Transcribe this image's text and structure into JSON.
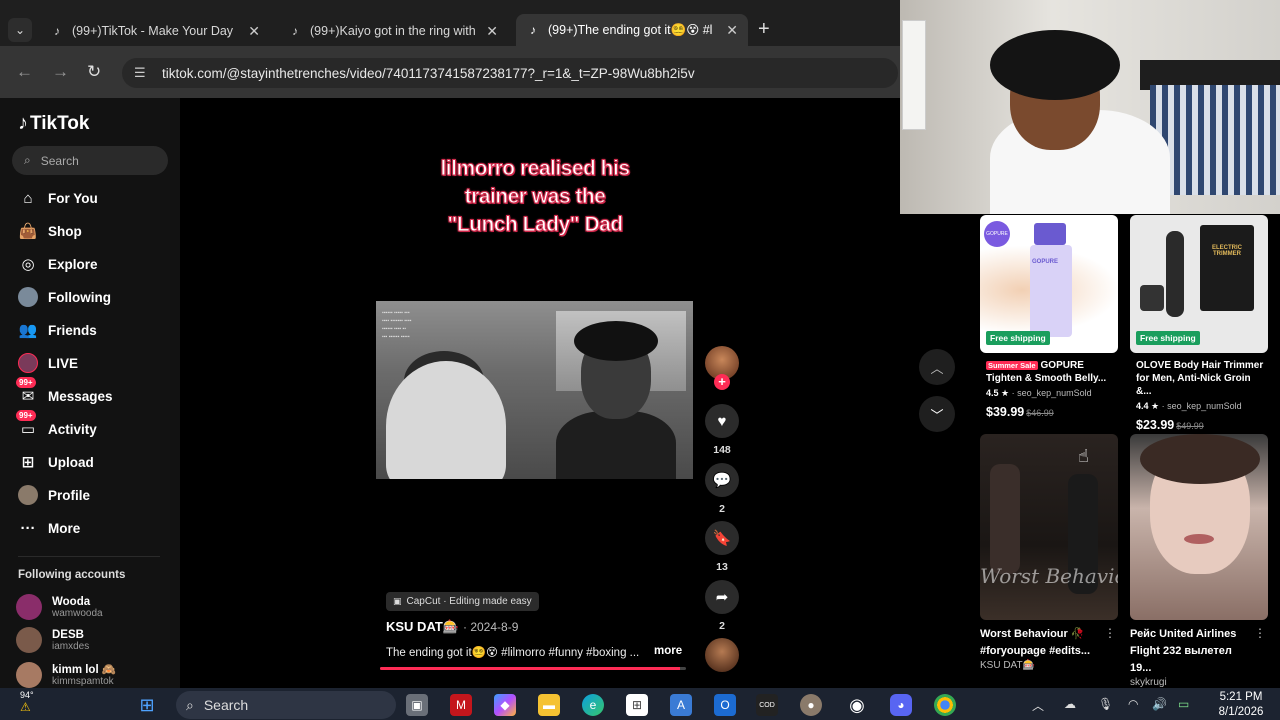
{
  "browser": {
    "tabs": [
      {
        "title": "(99+)TikTok - Make Your Day",
        "active": false
      },
      {
        "title": "(99+)Kaiyo got in the ring with",
        "active": false
      },
      {
        "title": "(99+)The ending got it😵‍💫😵 #l",
        "active": true
      }
    ],
    "url": "tiktok.com/@stayinthetrenches/video/7401173741587238177?_r=1&_t=ZP-98Wu8bh2i5v"
  },
  "sidebar": {
    "logo": "TikTok",
    "search_placeholder": "Search",
    "nav": [
      {
        "label": "For You",
        "icon": "home-icon"
      },
      {
        "label": "Shop",
        "icon": "shop-bag-icon"
      },
      {
        "label": "Explore",
        "icon": "compass-icon"
      },
      {
        "label": "Following",
        "icon": "following-avatar-icon"
      },
      {
        "label": "Friends",
        "icon": "friends-icon"
      },
      {
        "label": "LIVE",
        "icon": "live-icon"
      },
      {
        "label": "Messages",
        "icon": "messages-icon",
        "badge": "99+"
      },
      {
        "label": "Activity",
        "icon": "activity-icon",
        "badge": "99+"
      },
      {
        "label": "Upload",
        "icon": "upload-icon"
      },
      {
        "label": "Profile",
        "icon": "profile-avatar-icon"
      },
      {
        "label": "More",
        "icon": "more-dots-icon"
      }
    ],
    "following_title": "Following accounts",
    "accounts": [
      {
        "name": "Wooda",
        "handle": "wamwooda",
        "color": "#8a2d6a"
      },
      {
        "name": "DESB",
        "handle": "iamxdes",
        "color": "#7a5a4a"
      },
      {
        "name": "kimm lol 🙈",
        "handle": "kimmspamtok",
        "color": "#a77a63"
      }
    ]
  },
  "video": {
    "caption_lines": [
      "lilmorro realised his",
      "trainer was the",
      "\"Lunch Lady\" Dad"
    ],
    "likes": "148",
    "comments": "2",
    "saves": "13",
    "shares": "2",
    "capcut": "CapCut · Editing made easy",
    "author": "KSU DAT🎰",
    "date": "· 2024-8-9",
    "description": "The ending got it😵‍💫😵 #lilmorro #funny #boxing ...",
    "more": "more",
    "progress": 0.98
  },
  "shop": {
    "products": [
      {
        "sale": "Summer Sale",
        "title": "GOPURE Tighten & Smooth Belly...",
        "rating": "4.5",
        "sold": "· seo_kep_numSold",
        "price": "$39.99",
        "orig": "$46.99",
        "free": "Free shipping"
      },
      {
        "sale": "",
        "title": "OLOVE Body Hair Trimmer for Men, Anti-Nick Groin &...",
        "rating": "4.4",
        "sold": "· seo_kep_numSold",
        "price": "$23.99",
        "orig": "$49.99",
        "free": "Free shipping"
      }
    ],
    "videos": [
      {
        "title": "Worst Behaviour 🥀 #foryoupage #edits...",
        "author": "KSU DAT🎰",
        "overlay": "Worst Behavior"
      },
      {
        "title": "Рейс United Airlines Flight 232 вылетел 19...",
        "author": "skykrugi",
        "overlay": ""
      }
    ]
  },
  "product_images": {
    "gopure_brand": "GOPURE",
    "trimmer_brand": "ELECTRIC TRIMMER"
  },
  "taskbar": {
    "weather": "94°",
    "search": "Search",
    "time": "5:21 PM",
    "date": "8/1/2026"
  },
  "colors": {
    "accent": "#fe2c55",
    "free_shipping": "#1a9e5d",
    "sidebar_bg": "#121212"
  }
}
